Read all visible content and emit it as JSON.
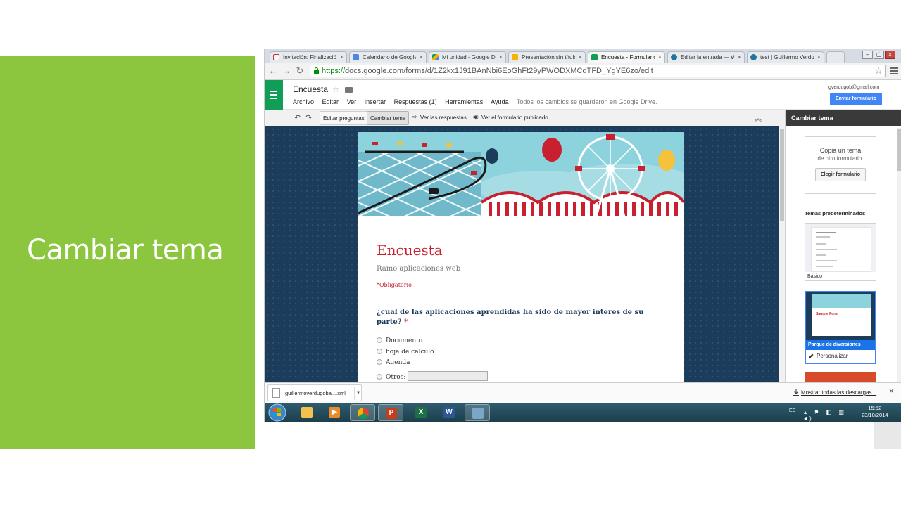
{
  "slide": {
    "title": "Cambiar tema",
    "accent_color": "#8cc63f"
  },
  "browser": {
    "tabs": [
      {
        "label": "Invitación: Finalizació",
        "icon": "gmail-icon",
        "active": false
      },
      {
        "label": "Calendario de Google",
        "icon": "calendar-icon",
        "active": false
      },
      {
        "label": "Mi unidad - Google Dr",
        "icon": "drive-icon",
        "active": false
      },
      {
        "label": "Presentación sin título",
        "icon": "slides-icon",
        "active": false
      },
      {
        "label": "Encuesta - Formulario",
        "icon": "forms-icon",
        "active": true
      },
      {
        "label": "Editar la entrada — W",
        "icon": "wordpress-icon",
        "active": false
      },
      {
        "label": "test | Guillermo Verdu",
        "icon": "wordpress-icon",
        "active": false
      }
    ],
    "tab_close": "×",
    "url_scheme": "https://",
    "url_rest": "docs.google.com/forms/d/1Z2kx1J91BAnNbi6EoGhFt29yPWODXMCdTFD_YgYE6zo/edit"
  },
  "app": {
    "doc_title": "Encuesta",
    "account": "gverdugob@gmail.com",
    "send_button": "Enviar formulario",
    "menu": [
      "Archivo",
      "Editar",
      "Ver",
      "Insertar",
      "Respuestas (1)",
      "Herramientas",
      "Ayuda"
    ],
    "saved_status": "Todos los cambios se guardaron en Google Drive."
  },
  "toolbar": {
    "edit_questions": "Editar preguntas",
    "change_theme": "Cambiar tema",
    "view_responses": "Ver las respuestas",
    "view_published": "Ver el formulario publicado"
  },
  "form": {
    "title": "Encuesta",
    "description": "Ramo aplicaciones web",
    "required_note": "*Obligatorio",
    "question": "¿cual de las aplicaciones aprendidas ha sido de mayor interes de su parte?",
    "required_mark": "*",
    "options": [
      "Documento",
      "hoja de calculo",
      "Agenda",
      "Otros:"
    ],
    "title_color": "#c8202f",
    "question_color": "#1c3c5c"
  },
  "theme_panel": {
    "header": "Cambiar tema",
    "copy_title": "Copia un tema",
    "copy_sub": "de otro formulario.",
    "choose_button": "Elegir formulario",
    "presets_label": "Temas predeterminados",
    "basic_caption": "Básico",
    "park_form_title": "Sample Form",
    "park_caption": "Parque de diversiones",
    "customize": "Personalizar"
  },
  "downloads": {
    "file_name": "guillermoverdugoba....xml",
    "show_all": "Mostrar todas las descargas...",
    "close": "×"
  },
  "taskbar": {
    "language": "ES",
    "time": "15:52",
    "date": "23/10/2014"
  }
}
